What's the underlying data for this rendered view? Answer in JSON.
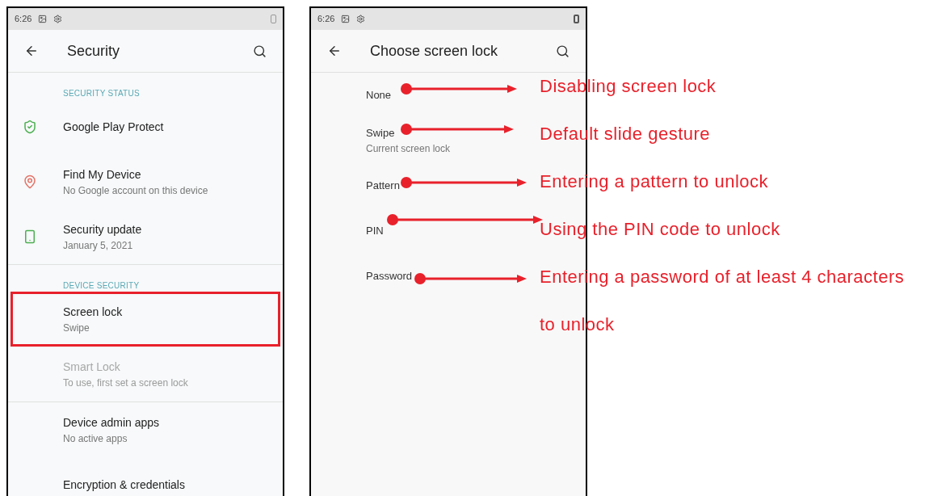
{
  "security_screen": {
    "status_bar": {
      "time": "6:26"
    },
    "title": "Security",
    "sections": [
      {
        "header": "SECURITY STATUS",
        "items": [
          {
            "title": "Google Play Protect",
            "kind": "shield",
            "disabled": false,
            "highlighted": false
          },
          {
            "title": "Find My Device",
            "subtitle": "No Google account on this device",
            "kind": "pin",
            "disabled": false,
            "highlighted": false
          },
          {
            "title": "Security update",
            "subtitle": "January 5, 2021",
            "kind": "phone",
            "disabled": false,
            "highlighted": false
          }
        ]
      },
      {
        "header": "DEVICE SECURITY",
        "items": [
          {
            "title": "Screen lock",
            "subtitle": "Swipe",
            "kind": "plain",
            "disabled": false,
            "highlighted": true
          },
          {
            "title": "Smart Lock",
            "subtitle": "To use, first set a screen lock",
            "kind": "plain",
            "disabled": true,
            "highlighted": false
          }
        ]
      },
      {
        "items": [
          {
            "title": "Device admin apps",
            "subtitle": "No active apps",
            "kind": "plain",
            "disabled": false,
            "highlighted": false
          },
          {
            "title": "Encryption & credentials",
            "kind": "plain",
            "disabled": false,
            "highlighted": false
          }
        ]
      }
    ]
  },
  "lock_screen": {
    "status_bar": {
      "time": "6:26"
    },
    "title": "Choose screen lock",
    "options": [
      {
        "label": "None",
        "annotation": "Disabling screen lock"
      },
      {
        "label": "Swipe",
        "subtitle": "Current screen lock",
        "annotation": "Default slide gesture"
      },
      {
        "label": "Pattern",
        "annotation": "Entering a pattern to unlock"
      },
      {
        "label": "PIN",
        "annotation": "Using the PIN code to unlock"
      },
      {
        "label": "Password",
        "annotation": "Entering a password of at least 4 characters to unlock"
      }
    ]
  }
}
